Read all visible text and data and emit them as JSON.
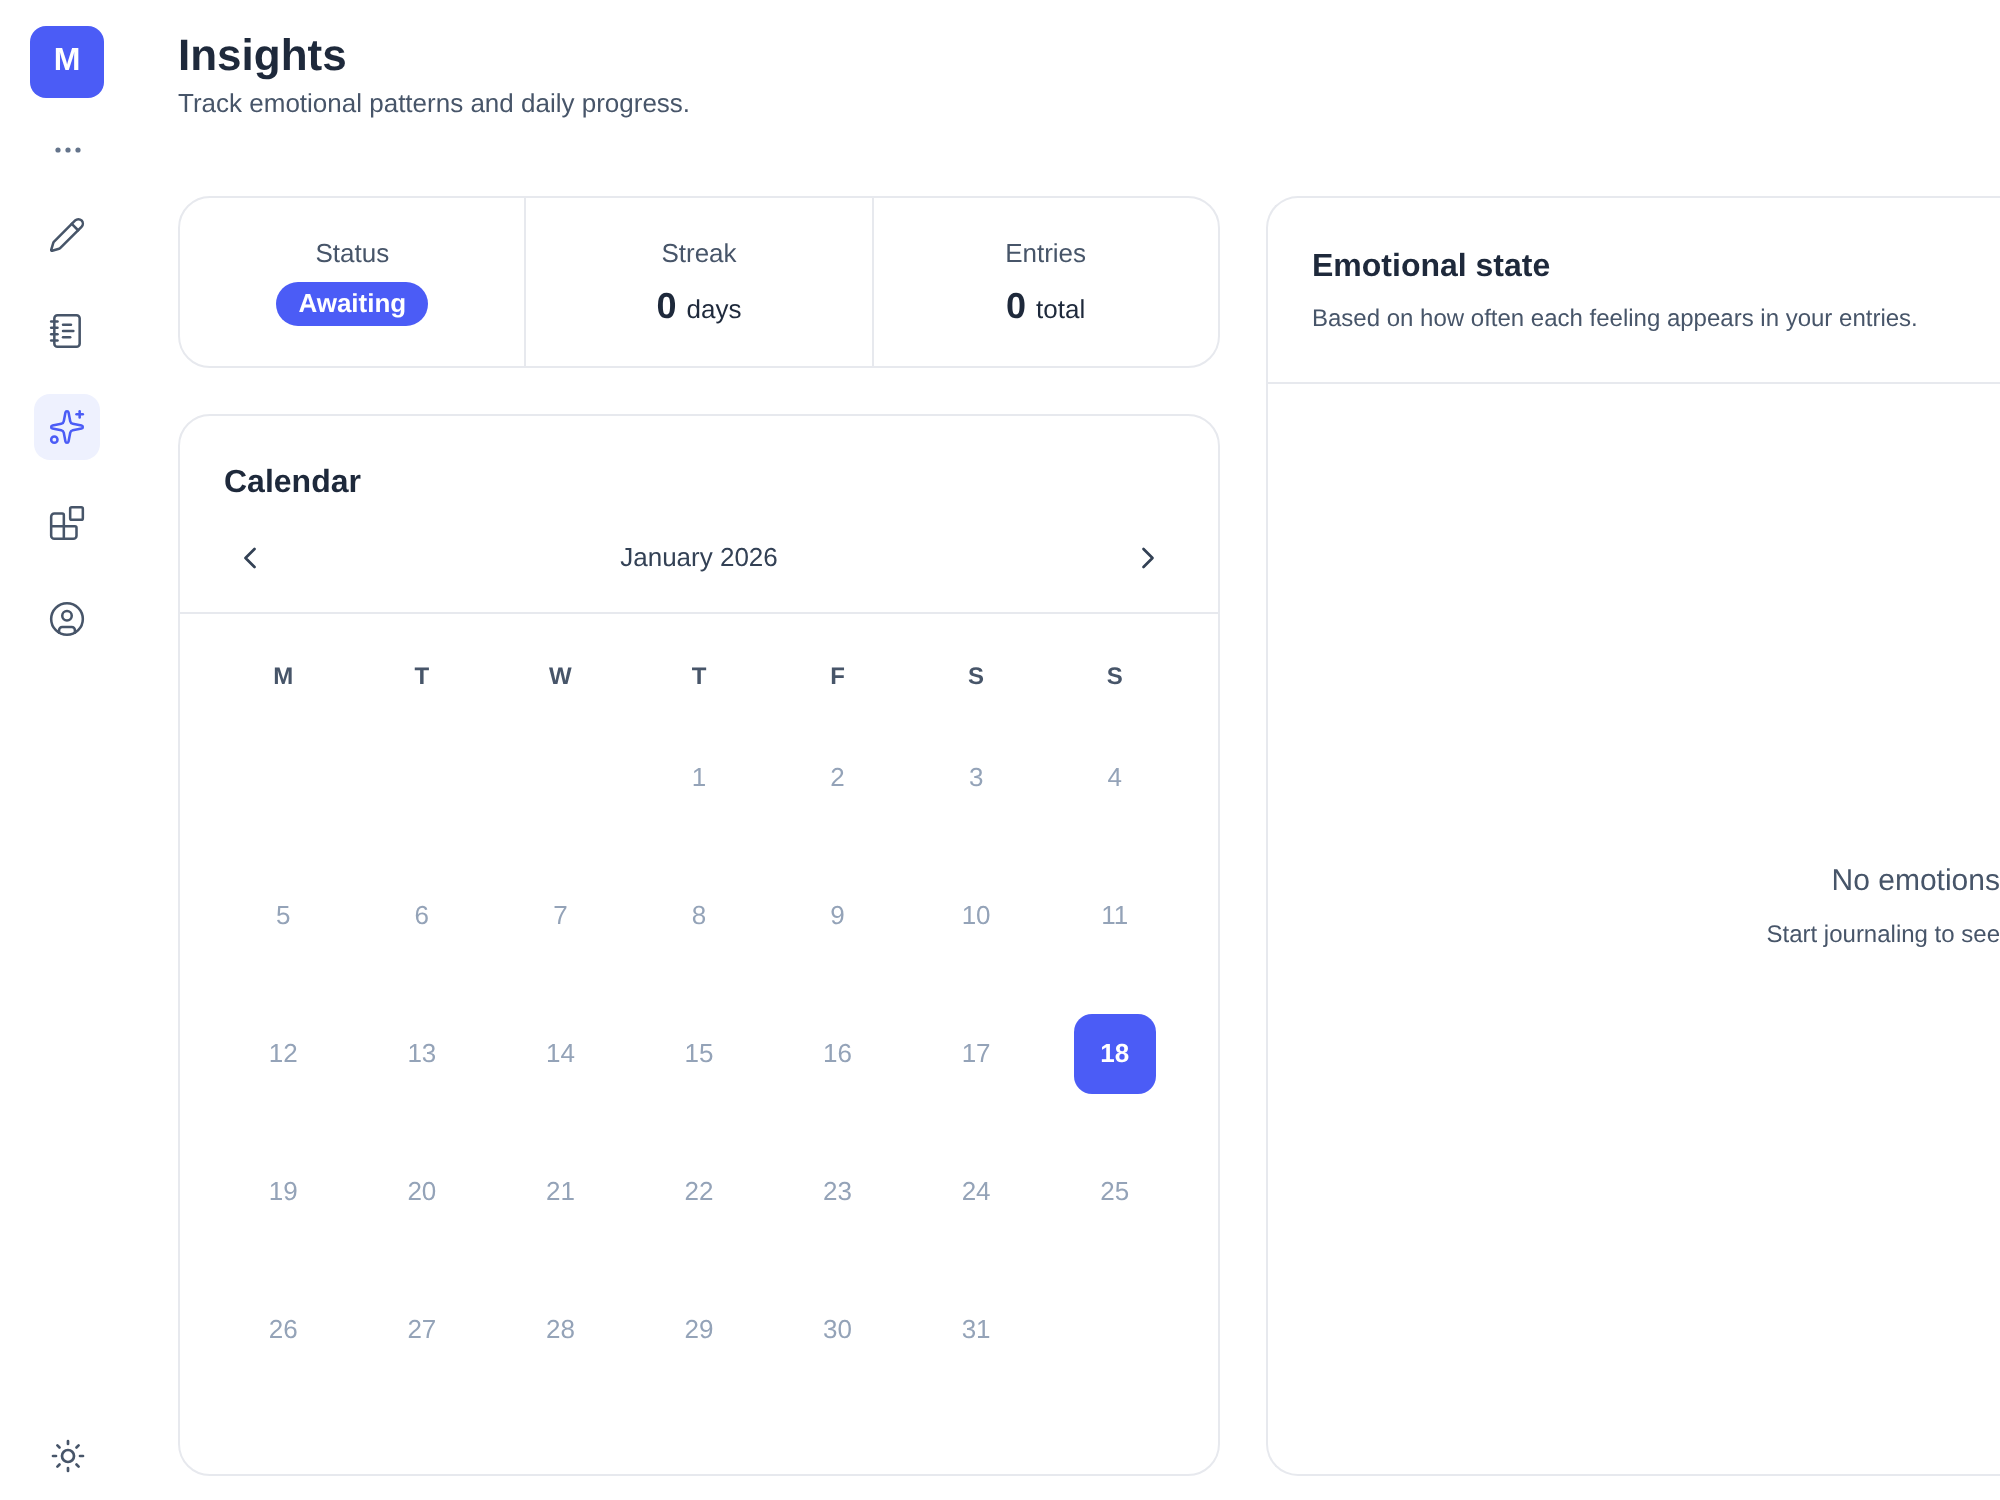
{
  "sidebar": {
    "logo": "M",
    "items": [
      {
        "kind": "pencil",
        "selected": false
      },
      {
        "kind": "notebook",
        "selected": false
      },
      {
        "kind": "sparkles",
        "selected": true
      },
      {
        "kind": "blocks",
        "selected": false
      },
      {
        "kind": "user",
        "selected": false
      }
    ]
  },
  "header": {
    "title": "Insights",
    "subtitle": "Track emotional patterns and daily progress."
  },
  "stats": [
    {
      "kind": "badge",
      "label": "Status",
      "badge": "Awaiting"
    },
    {
      "kind": "count",
      "label": "Streak",
      "value": "0",
      "unit": "days"
    },
    {
      "kind": "count",
      "label": "Entries",
      "value": "0",
      "unit": "total"
    }
  ],
  "calendar": {
    "title": "Calendar",
    "month": "January 2026",
    "weekdays": [
      "M",
      "T",
      "W",
      "T",
      "F",
      "S",
      "S"
    ],
    "weeks": [
      [
        {
          "day": "1",
          "selected": false
        },
        {
          "day": "2",
          "selected": false
        },
        {
          "day": "3",
          "selected": false
        },
        {
          "day": "4",
          "selected": false
        }
      ],
      [
        {
          "day": "5",
          "selected": false
        },
        {
          "day": "6",
          "selected": false
        },
        {
          "day": "7",
          "selected": false
        },
        {
          "day": "8",
          "selected": false
        },
        {
          "day": "9",
          "selected": false
        },
        {
          "day": "10",
          "selected": false
        },
        {
          "day": "11",
          "selected": false
        }
      ],
      [
        {
          "day": "12",
          "selected": false
        },
        {
          "day": "13",
          "selected": false
        },
        {
          "day": "14",
          "selected": false
        },
        {
          "day": "15",
          "selected": false
        },
        {
          "day": "16",
          "selected": false
        },
        {
          "day": "17",
          "selected": false
        },
        {
          "day": "18",
          "selected": true
        }
      ],
      [
        {
          "day": "19",
          "selected": false
        },
        {
          "day": "20",
          "selected": false
        },
        {
          "day": "21",
          "selected": false
        },
        {
          "day": "22",
          "selected": false
        },
        {
          "day": "23",
          "selected": false
        },
        {
          "day": "24",
          "selected": false
        },
        {
          "day": "25",
          "selected": false
        }
      ],
      [
        {
          "day": "26",
          "selected": false
        },
        {
          "day": "27",
          "selected": false
        },
        {
          "day": "28",
          "selected": false
        },
        {
          "day": "29",
          "selected": false
        },
        {
          "day": "30",
          "selected": false
        },
        {
          "day": "31",
          "selected": false
        }
      ]
    ]
  },
  "emotional_state": {
    "title": "Emotional state",
    "subtitle": "Based on how often each feeling appears in your entries.",
    "empty_title": "No emotions",
    "empty_text": "Start journaling to see"
  }
}
